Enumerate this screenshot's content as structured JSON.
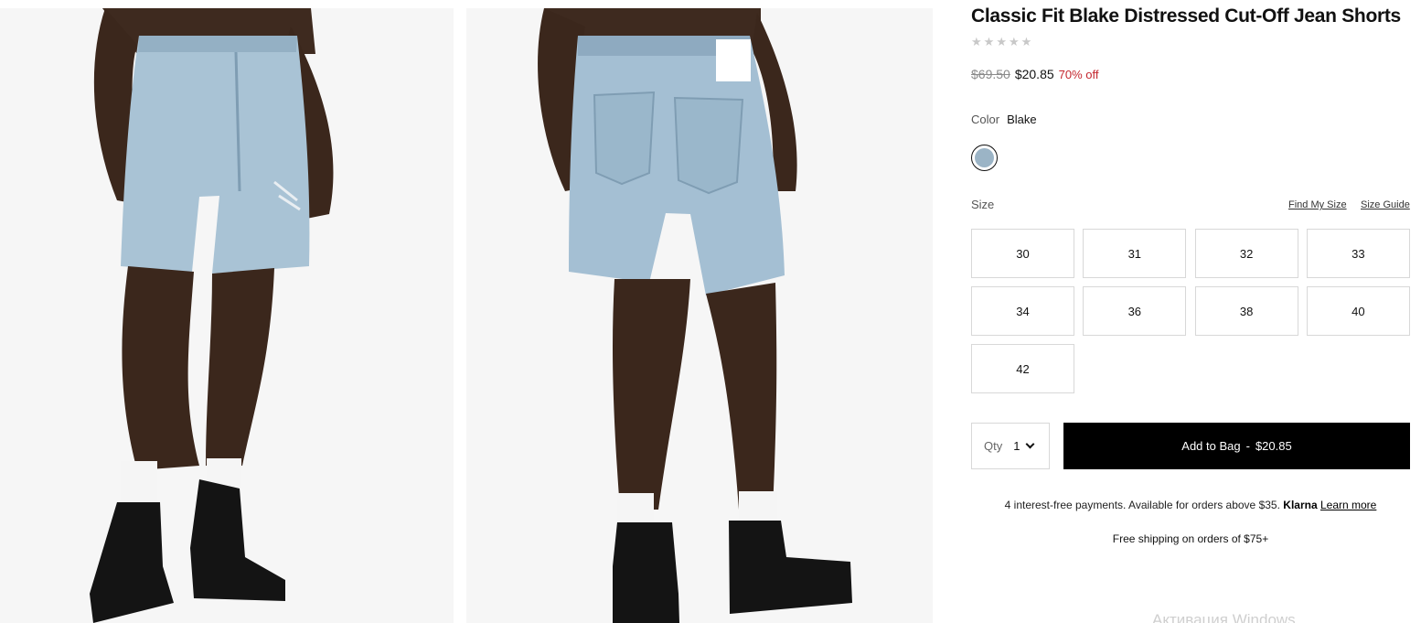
{
  "product": {
    "title": "Classic Fit Blake Distressed Cut-Off Jean Shorts",
    "rating_stars": [
      "★",
      "★",
      "★",
      "★",
      "★"
    ],
    "rating_color": "#c8c8c8"
  },
  "price": {
    "original": "$69.50",
    "sale": "$20.85",
    "discount": "70% off",
    "discount_color": "#c4262e"
  },
  "color": {
    "label": "Color",
    "value": "Blake",
    "swatch_color": "#9bb4c6"
  },
  "size": {
    "label": "Size",
    "find_my_size": "Find My Size",
    "size_guide": "Size Guide",
    "options": [
      "30",
      "31",
      "32",
      "33",
      "34",
      "36",
      "38",
      "40",
      "42"
    ]
  },
  "purchase": {
    "qty_label": "Qty",
    "qty_value": "1",
    "add_to_bag": "Add to Bag",
    "separator": "-",
    "add_price": "$20.85",
    "button_color": "#000000"
  },
  "klarna": {
    "text": "4 interest-free payments. Available for orders above $35.",
    "brand": "Klarna",
    "learn_more": "Learn more"
  },
  "shipping": "Free shipping on orders of $75+",
  "watermark": "Активация Windows",
  "images": [
    {
      "name": "product-image-front",
      "icon": "jeans-shorts-front-photo"
    },
    {
      "name": "product-image-back",
      "icon": "jeans-shorts-back-photo"
    }
  ]
}
